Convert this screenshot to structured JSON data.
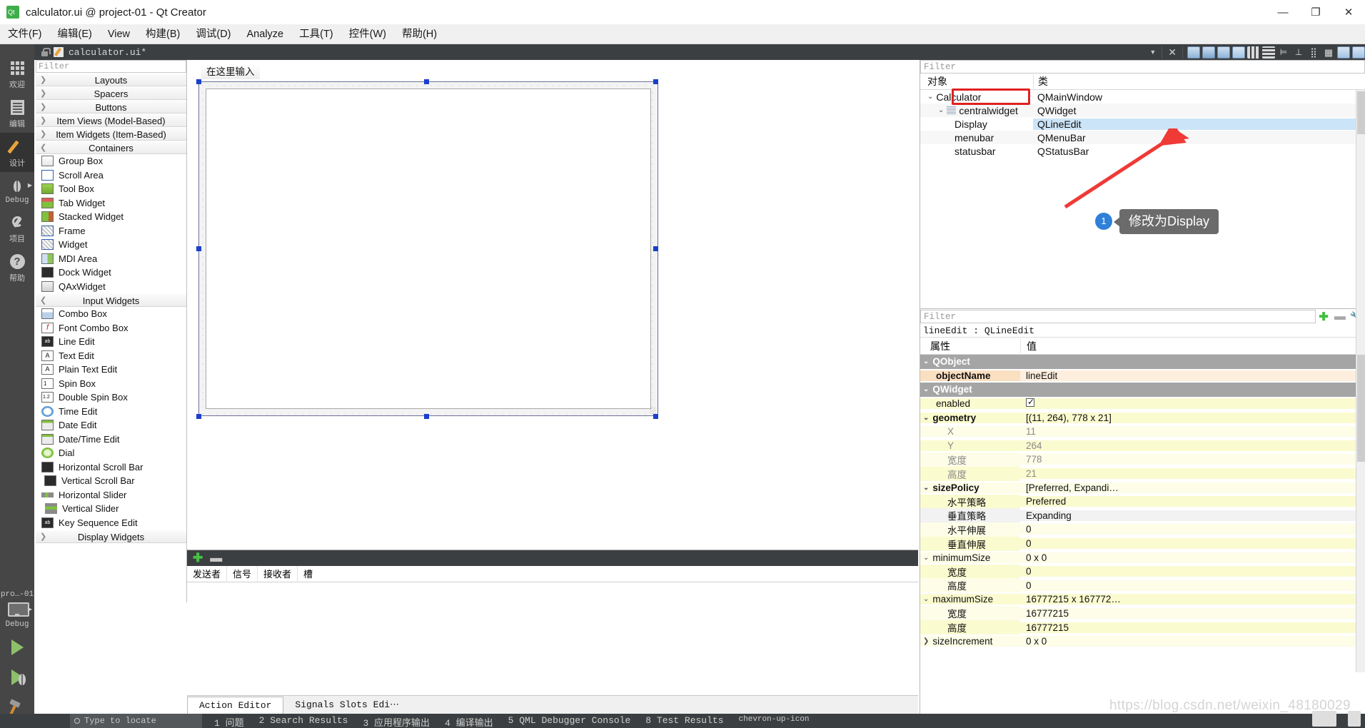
{
  "window": {
    "title": "calculator.ui @ project-01 - Qt Creator",
    "app_icon": "qt-logo-icon",
    "minimize": "—",
    "maximize": "❐",
    "close": "✕"
  },
  "menubar": {
    "items": [
      {
        "label": "文件(F)"
      },
      {
        "label": "编辑(E)"
      },
      {
        "label": "View"
      },
      {
        "label": "构建(B)"
      },
      {
        "label": "调试(D)"
      },
      {
        "label": "Analyze"
      },
      {
        "label": "工具(T)"
      },
      {
        "label": "控件(W)"
      },
      {
        "label": "帮助(H)"
      }
    ]
  },
  "modebar": {
    "items": [
      {
        "label": "欢迎",
        "icon": "grid-icon",
        "active": false
      },
      {
        "label": "编辑",
        "icon": "document-icon",
        "active": false
      },
      {
        "label": "设计",
        "icon": "pencil-icon",
        "active": true
      },
      {
        "label": "Debug",
        "icon": "bug-icon",
        "active": false,
        "has_arrow": true
      },
      {
        "label": "项目",
        "icon": "wrench-icon",
        "active": false
      },
      {
        "label": "帮助",
        "icon": "question-circle-icon",
        "active": false
      }
    ],
    "kit_label": "pro…-01",
    "kit_sub": "Debug",
    "kit_icon": "monitor-icon",
    "run_icon": "run-triangle-icon",
    "debug_icon": "debug-run-icon",
    "build_icon": "hammer-icon"
  },
  "editor_toolbar": {
    "lock_icon": "unlocked-icon",
    "file_icon": "ui-file-icon",
    "filename": "calculator.ui*",
    "dropdown_icon": "chevron-down-icon",
    "close_icon": "close-icon",
    "form_tools": [
      "edit-widgets-icon",
      "edit-signals-slots-icon",
      "edit-buddies-icon",
      "edit-tab-order-icon",
      "layout-horizontal-icon",
      "layout-vertical-icon",
      "layout-splitter-h-icon",
      "layout-splitter-v-icon",
      "layout-form-icon",
      "layout-grid-icon",
      "break-layout-icon",
      "adjust-size-icon"
    ]
  },
  "widget_box": {
    "filter_placeholder": "Filter",
    "categories": [
      {
        "label": "Layouts",
        "expanded": false,
        "items": []
      },
      {
        "label": "Spacers",
        "expanded": false,
        "items": []
      },
      {
        "label": "Buttons",
        "expanded": false,
        "items": []
      },
      {
        "label": "Item Views (Model-Based)",
        "expanded": false,
        "items": []
      },
      {
        "label": "Item Widgets (Item-Based)",
        "expanded": false,
        "items": []
      },
      {
        "label": "Containers",
        "expanded": true,
        "items": [
          {
            "label": "Group Box",
            "icon": "group-box-icon"
          },
          {
            "label": "Scroll Area",
            "icon": "scroll-area-icon"
          },
          {
            "label": "Tool Box",
            "icon": "tool-box-icon"
          },
          {
            "label": "Tab Widget",
            "icon": "tab-widget-icon"
          },
          {
            "label": "Stacked Widget",
            "icon": "stacked-widget-icon"
          },
          {
            "label": "Frame",
            "icon": "frame-icon"
          },
          {
            "label": "Widget",
            "icon": "widget-icon"
          },
          {
            "label": "MDI Area",
            "icon": "mdi-area-icon"
          },
          {
            "label": "Dock Widget",
            "icon": "dock-widget-icon"
          },
          {
            "label": "QAxWidget",
            "icon": "qax-widget-icon"
          }
        ]
      },
      {
        "label": "Input Widgets",
        "expanded": true,
        "items": [
          {
            "label": "Combo Box",
            "icon": "combo-box-icon"
          },
          {
            "label": "Font Combo Box",
            "icon": "font-combo-box-icon"
          },
          {
            "label": "Line Edit",
            "icon": "line-edit-icon"
          },
          {
            "label": "Text Edit",
            "icon": "text-edit-icon"
          },
          {
            "label": "Plain Text Edit",
            "icon": "plain-text-edit-icon"
          },
          {
            "label": "Spin Box",
            "icon": "spin-box-icon"
          },
          {
            "label": "Double Spin Box",
            "icon": "double-spin-box-icon"
          },
          {
            "label": "Time Edit",
            "icon": "time-edit-icon"
          },
          {
            "label": "Date Edit",
            "icon": "date-edit-icon"
          },
          {
            "label": "Date/Time Edit",
            "icon": "date-time-edit-icon"
          },
          {
            "label": "Dial",
            "icon": "dial-icon"
          },
          {
            "label": "Horizontal Scroll Bar",
            "icon": "h-scrollbar-icon"
          },
          {
            "label": "Vertical Scroll Bar",
            "icon": "v-scrollbar-icon"
          },
          {
            "label": "Horizontal Slider",
            "icon": "h-slider-icon"
          },
          {
            "label": "Vertical Slider",
            "icon": "v-slider-icon"
          },
          {
            "label": "Key Sequence Edit",
            "icon": "key-sequence-edit-icon"
          }
        ]
      },
      {
        "label": "Display Widgets",
        "expanded": false,
        "items": []
      }
    ]
  },
  "canvas": {
    "menu_placeholder": "在这里输入",
    "form_name": "Calculator"
  },
  "signals_dock": {
    "add_icon": "plus-icon",
    "remove_icon": "minus-icon",
    "columns": [
      "发送者",
      "信号",
      "接收者",
      "槽"
    ],
    "tabs": [
      {
        "label": "Action Editor",
        "active": true
      },
      {
        "label": "Signals  Slots Edi⋯",
        "active": false
      }
    ]
  },
  "object_inspector": {
    "filter_placeholder": "Filter",
    "columns": [
      "对象",
      "类"
    ],
    "rows": [
      {
        "name": "Calculator",
        "class": "QMainWindow",
        "indent": 0,
        "chevron": "down",
        "icon": null,
        "selected": false
      },
      {
        "name": "centralwidget",
        "class": "QWidget",
        "indent": 1,
        "chevron": "down",
        "icon": "widget-icon",
        "selected": false
      },
      {
        "name": "Display",
        "class": "QLineEdit",
        "indent": 2,
        "chevron": null,
        "icon": null,
        "selected": true
      },
      {
        "name": "menubar",
        "class": "QMenuBar",
        "indent": 1,
        "chevron": null,
        "icon": null,
        "selected": false
      },
      {
        "name": "statusbar",
        "class": "QStatusBar",
        "indent": 1,
        "chevron": null,
        "icon": null,
        "selected": false
      }
    ]
  },
  "property_editor": {
    "filter_placeholder": "Filter",
    "add_icon": "plus-icon",
    "remove_icon": "minus-icon",
    "config_icon": "wrench-icon",
    "object_line": "lineEdit : QLineEdit",
    "columns": [
      "属性",
      "值"
    ],
    "rows": [
      {
        "key": "QObject",
        "value": "",
        "type": "group",
        "chevron": "down",
        "indent": 0
      },
      {
        "key": "objectName",
        "value": "lineEdit",
        "type": "modified",
        "chevron": null,
        "indent": 1,
        "bold": true
      },
      {
        "key": "QWidget",
        "value": "",
        "type": "group",
        "chevron": "down",
        "indent": 0
      },
      {
        "key": "enabled",
        "value": "",
        "type": "y1",
        "chevron": null,
        "indent": 1,
        "checkbox": true
      },
      {
        "key": "geometry",
        "value": "[(11, 264), 778 x 21]",
        "type": "y1",
        "chevron": "down",
        "indent": 0,
        "bold": true
      },
      {
        "key": "X",
        "value": "11",
        "type": "y2",
        "chevron": null,
        "indent": 2,
        "muted": true
      },
      {
        "key": "Y",
        "value": "264",
        "type": "y1",
        "chevron": null,
        "indent": 2,
        "muted": true
      },
      {
        "key": "宽度",
        "value": "778",
        "type": "y2",
        "chevron": null,
        "indent": 2,
        "muted": true
      },
      {
        "key": "高度",
        "value": "21",
        "type": "y1",
        "chevron": null,
        "indent": 2,
        "muted": true
      },
      {
        "key": "sizePolicy",
        "value": "[Preferred, Expandi…",
        "type": "y2",
        "chevron": "down",
        "indent": 0,
        "bold": true
      },
      {
        "key": "水平策略",
        "value": "Preferred",
        "type": "y1",
        "chevron": null,
        "indent": 2
      },
      {
        "key": "垂直策略",
        "value": "Expanding",
        "type": "gy",
        "chevron": null,
        "indent": 2
      },
      {
        "key": "水平伸展",
        "value": "0",
        "type": "y2",
        "chevron": null,
        "indent": 2
      },
      {
        "key": "垂直伸展",
        "value": "0",
        "type": "y1",
        "chevron": null,
        "indent": 2
      },
      {
        "key": "minimumSize",
        "value": "0 x 0",
        "type": "y2",
        "chevron": "down",
        "indent": 0
      },
      {
        "key": "宽度",
        "value": "0",
        "type": "y1",
        "chevron": null,
        "indent": 2
      },
      {
        "key": "高度",
        "value": "0",
        "type": "y2",
        "chevron": null,
        "indent": 2
      },
      {
        "key": "maximumSize",
        "value": "16777215 x 167772…",
        "type": "y1",
        "chevron": "down",
        "indent": 0
      },
      {
        "key": "宽度",
        "value": "16777215",
        "type": "y2",
        "chevron": null,
        "indent": 2
      },
      {
        "key": "高度",
        "value": "16777215",
        "type": "y1",
        "chevron": null,
        "indent": 2
      },
      {
        "key": "sizeIncrement",
        "value": "0 x 0",
        "type": "y2",
        "chevron": "right",
        "indent": 0
      }
    ]
  },
  "annotation": {
    "badge": "1",
    "text": "修改为Display",
    "arrow_color": "#ef3a36",
    "badge_color": "#2f80d8",
    "highlight_color": "#e02020"
  },
  "statusbar": {
    "search_placeholder": "Type to locate (Ctrl+K)",
    "search_icon": "search-icon",
    "items": [
      "1 问题",
      "2 Search Results",
      "3 应用程序输出",
      "4 编译输出",
      "5 QML Debugger Console",
      "8 Test Results"
    ],
    "collapse_icon": "chevron-up-icon"
  },
  "watermark": "https://blog.csdn.net/weixin_48180029"
}
